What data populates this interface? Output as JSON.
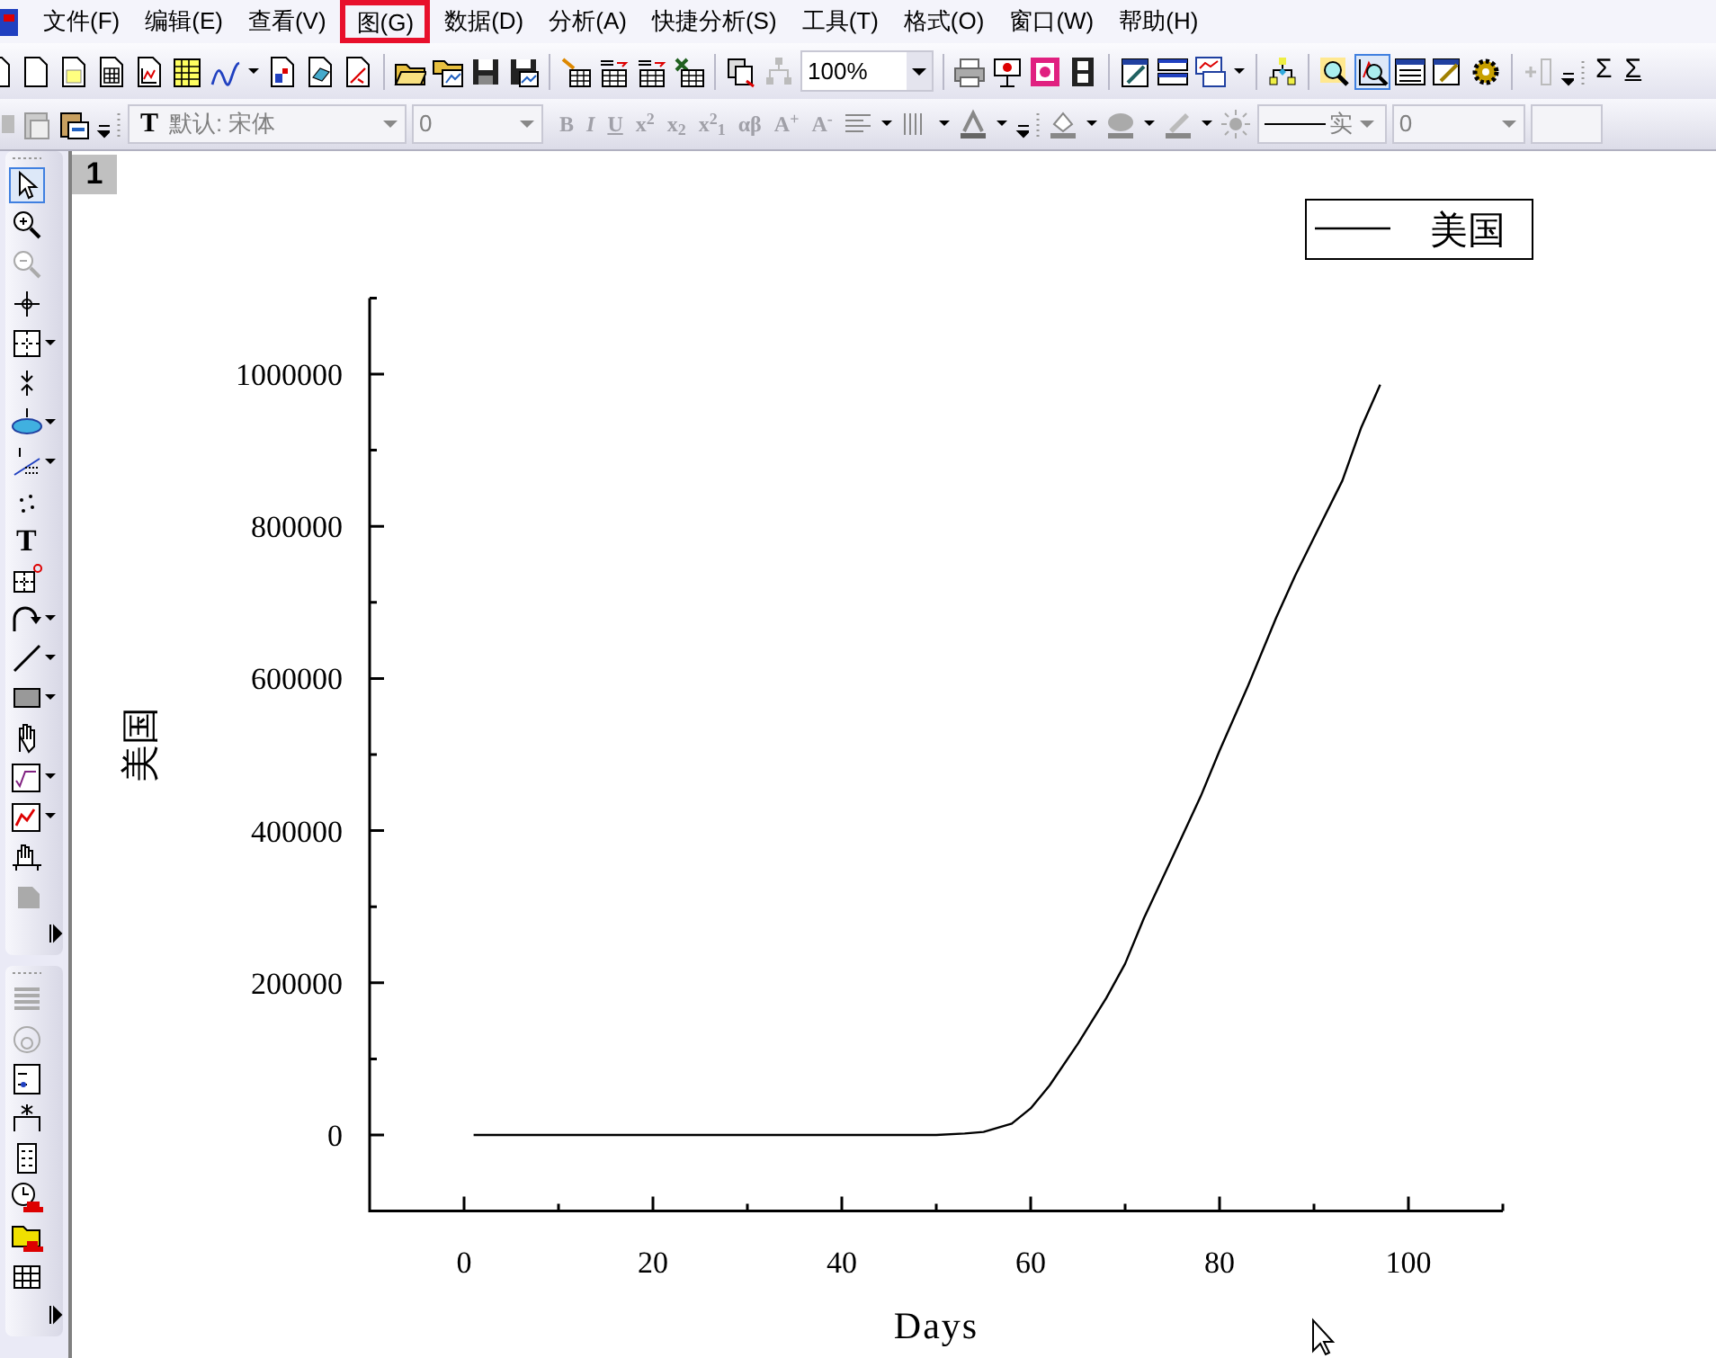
{
  "menu": [
    {
      "label": "文件(F)",
      "highlighted": false
    },
    {
      "label": "编辑(E)",
      "highlighted": false
    },
    {
      "label": "查看(V)",
      "highlighted": false
    },
    {
      "label": "图(G)",
      "highlighted": true
    },
    {
      "label": "数据(D)",
      "highlighted": false
    },
    {
      "label": "分析(A)",
      "highlighted": false
    },
    {
      "label": "快捷分析(S)",
      "highlighted": false
    },
    {
      "label": "工具(T)",
      "highlighted": false
    },
    {
      "label": "格式(O)",
      "highlighted": false
    },
    {
      "label": "窗口(W)",
      "highlighted": false
    },
    {
      "label": "帮助(H)",
      "highlighted": false
    }
  ],
  "zoom_field": {
    "value": "100%"
  },
  "sum_buttons": [
    "Σ",
    "Σ"
  ],
  "font_field": {
    "icon": "T",
    "value": "默认: 宋体"
  },
  "size_field": {
    "value": "0"
  },
  "format_buttons": [
    {
      "label": "B",
      "disabled": true
    },
    {
      "label": "I",
      "disabled": true
    },
    {
      "label": "U",
      "disabled": true
    },
    {
      "label": "x$^{2}$",
      "disabled": true
    },
    {
      "label": "x$_{2}$",
      "disabled": true
    },
    {
      "label": "x$^{2}$$_{1}$",
      "disabled": true
    },
    {
      "label": "αβ",
      "disabled": true
    },
    {
      "label": "A$^{+}$",
      "disabled": true
    },
    {
      "label": "A$^{-}$",
      "disabled": true
    }
  ],
  "line_style_field": {
    "value": "实"
  },
  "line_width_field": {
    "value": "0"
  },
  "text_tool": "T",
  "page_number": "1",
  "graph": {
    "chart_data": {
      "type": "line",
      "xlabel": "Days",
      "ylabel": "美国",
      "xlim": [
        -10,
        110
      ],
      "ylim": [
        -100000,
        1100000
      ],
      "xticks": [
        0,
        20,
        40,
        60,
        80,
        100
      ],
      "yticks": [
        {
          "value": 0,
          "label": "0"
        },
        {
          "value": 200000,
          "label": "200000"
        },
        {
          "value": 400000,
          "label": "400000"
        },
        {
          "value": 600000,
          "label": "600000"
        },
        {
          "value": 800000,
          "label": "800000"
        },
        {
          "value": 1000000,
          "label": "1000000"
        }
      ],
      "x": [
        1,
        10,
        20,
        30,
        40,
        50,
        53,
        55,
        58,
        60,
        62,
        65,
        68,
        70,
        72,
        75,
        78,
        80,
        83,
        86,
        88,
        90,
        93,
        95,
        97
      ],
      "series": [
        {
          "name": "美国",
          "color": "#000000",
          "values": [
            0,
            0,
            0,
            0,
            0,
            0,
            2000,
            4000,
            15000,
            35000,
            65000,
            120000,
            180000,
            225000,
            285000,
            365000,
            445000,
            505000,
            590000,
            680000,
            735000,
            785000,
            860000,
            930000,
            986000
          ]
        }
      ]
    }
  }
}
